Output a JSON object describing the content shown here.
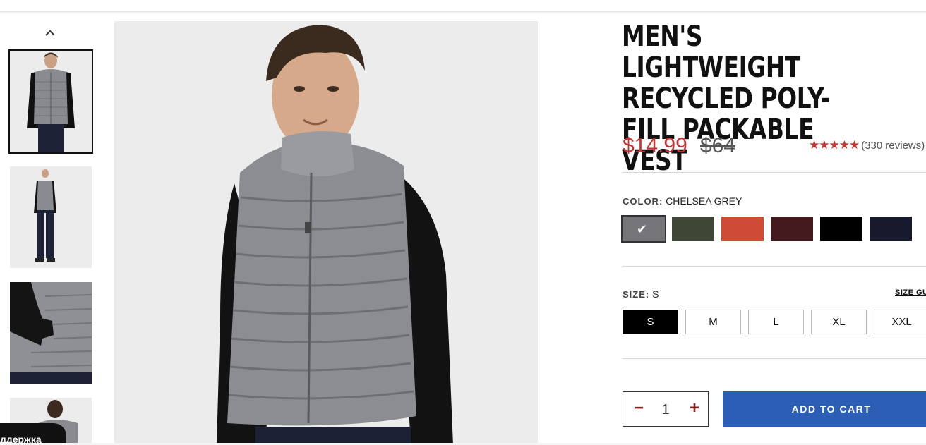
{
  "product": {
    "title": "MEN'S LIGHTWEIGHT RECYCLED POLY-FILL PACKABLE VEST",
    "price_sale": "$14.99",
    "price_original": "$64",
    "rating_stars": "★★★★★",
    "rating_value": 5,
    "reviews_text": "(330 reviews)"
  },
  "color": {
    "label": "COLOR:",
    "selected_name": "CHELSEA GREY",
    "check_glyph": "✔",
    "swatches": [
      {
        "name": "Chelsea Grey",
        "hex": "#76767a"
      },
      {
        "name": "Olive",
        "hex": "#3f4636"
      },
      {
        "name": "Red Orange",
        "hex": "#cf4b36"
      },
      {
        "name": "Burgundy",
        "hex": "#441a1f"
      },
      {
        "name": "Black",
        "hex": "#000000"
      },
      {
        "name": "Navy",
        "hex": "#171a2c"
      }
    ]
  },
  "size": {
    "label": "SIZE:",
    "selected": "S",
    "guide_label": "SIZE GUIDE",
    "options": [
      "S",
      "M",
      "L",
      "XL",
      "XXL"
    ]
  },
  "cart": {
    "quantity": "1",
    "minus_glyph": "−",
    "plus_glyph": "+",
    "add_label": "ADD TO CART"
  },
  "support_chip": "ддержка",
  "colors": {
    "sale_red": "#c8312f",
    "cart_blue": "#2a5fb5"
  }
}
